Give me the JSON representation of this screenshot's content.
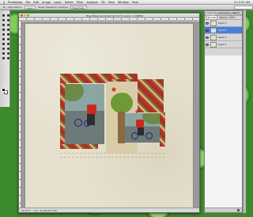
{
  "app": {
    "menu": [
      "Photoshop",
      "File",
      "Edit",
      "Image",
      "Layer",
      "Select",
      "Filter",
      "Analysis",
      "3D",
      "View",
      "Window",
      "Help"
    ],
    "clock": "Fri 9:32 AM"
  },
  "options": {
    "labels": [
      "Auto-Select:",
      "Layer",
      "Show Transform Controls"
    ],
    "workspace": "Essentials",
    "search_placeholder": ""
  },
  "document": {
    "title": "Busy Bees layout.psd @ 16.7% (Layer 4, RGB/8)",
    "zoom": "16.67%",
    "doc_size": "Doc: 34.3M/167.0M"
  },
  "layers_panel": {
    "tabs": [
      "Layers",
      "Channels",
      "Paths"
    ],
    "blend_mode": "Normal",
    "opacity_label": "Opacity: 100%",
    "layers": [
      {
        "name": "Layer 5",
        "selected": false
      },
      {
        "name": "Layer 4",
        "selected": true
      },
      {
        "name": "Layer 3",
        "selected": false
      },
      {
        "name": "Layer 2",
        "selected": false
      }
    ]
  },
  "colors": {
    "accent": "#4a7fd6",
    "stripe_red": "#a5342a",
    "paper": "#e6e1cf",
    "foliage": "#3d8a2e"
  }
}
